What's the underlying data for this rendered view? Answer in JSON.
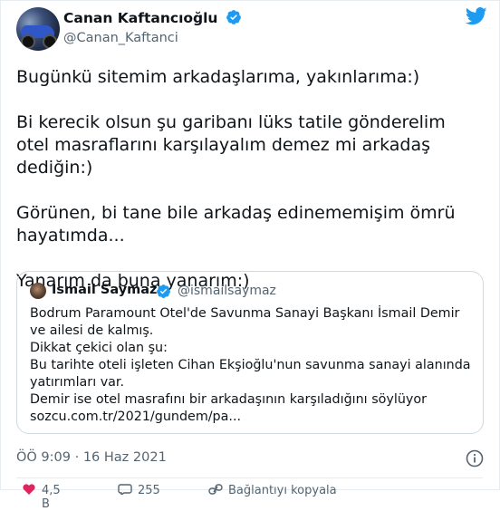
{
  "author": {
    "display_name": "Canan Kaftancıoğlu",
    "handle": "@Canan_Kaftanci"
  },
  "tweet": {
    "lines": [
      "Bugünkü sitemim arkadaşlarıma, yakınlarıma:)",
      "Bi kerecik olsun şu garibanı lüks tatile gönderelim otel masraflarını karşılayalım demez mi arkadaş dediğin:)",
      "Görünen, bi tane bile arkadaş edinememişim ömrü hayatımda...",
      "Yanarım da buna yanarım:)"
    ],
    "timestamp": "ÖÖ 9:09 · 16 Haz 2021"
  },
  "quoted": {
    "display_name": "İsmail Saymaz",
    "handle": "@ismailsaymaz",
    "lines": [
      "Bodrum Paramount Otel'de Savunma Sanayi Başkanı İsmail Demir ve ailesi de kalmış.",
      "Dikkat çekici olan şu:",
      "Bu tarihte oteli işleten Cihan Ekşioğlu'nun savunma sanayi alanında yatırımları var.",
      "Demir ise otel masrafını bir arkadaşının karşıladığını söylüyor",
      "sozcu.com.tr/2021/gundem/pa..."
    ]
  },
  "actions": {
    "likes": "4,5 B",
    "replies": "255",
    "share_label": "Bağlantıyı kopyala"
  },
  "colors": {
    "twitter_blue": "#1d9bf0",
    "text": "#0f1419",
    "secondary": "#536471",
    "border": "#cfd9de"
  },
  "icons": {
    "verified": "verified-badge-icon",
    "logo": "twitter-bird-icon",
    "info": "info-icon"
  }
}
